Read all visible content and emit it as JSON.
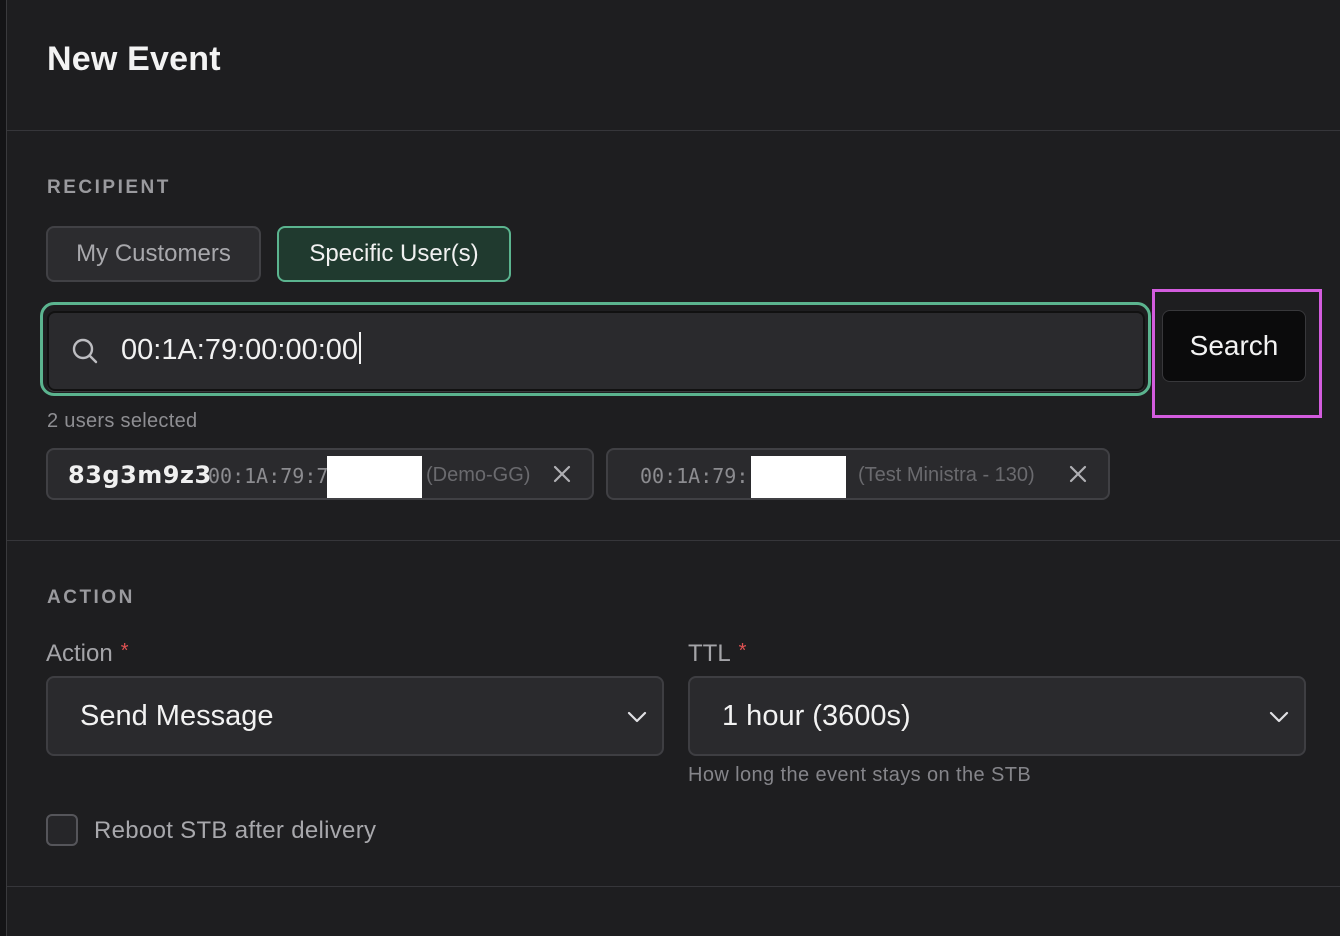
{
  "dialog": {
    "title": "New Event"
  },
  "recipient": {
    "section_label": "RECIPIENT",
    "tabs": [
      {
        "label": "My Customers",
        "active": false
      },
      {
        "label": "Specific User(s)",
        "active": true
      }
    ],
    "search": {
      "value": "00:1A:79:00:00:00",
      "icon": "search-icon"
    },
    "search_button_label": "Search",
    "selected_count_text": "2 users selected",
    "chips": [
      {
        "name": "83g3m9z3",
        "mac": "00:1A:79:7",
        "label": "(Demo-GG)",
        "close_icon": "close-icon"
      },
      {
        "name": "",
        "mac": "00:1A:79:",
        "label": "(Test Ministra - 130)",
        "close_icon": "close-icon"
      }
    ]
  },
  "action": {
    "section_label": "ACTION",
    "action_field": {
      "label": "Action",
      "required_mark": "*",
      "value": "Send Message"
    },
    "ttl_field": {
      "label": "TTL",
      "required_mark": "*",
      "value": "1 hour (3600s)",
      "helper": "How long the event stays on the STB"
    },
    "reboot_checkbox": {
      "label": "Reboot STB after delivery",
      "checked": false
    }
  },
  "colors": {
    "accent_green": "#5bb48f",
    "highlight_magenta": "#d35cde",
    "required_red": "#e05252"
  }
}
